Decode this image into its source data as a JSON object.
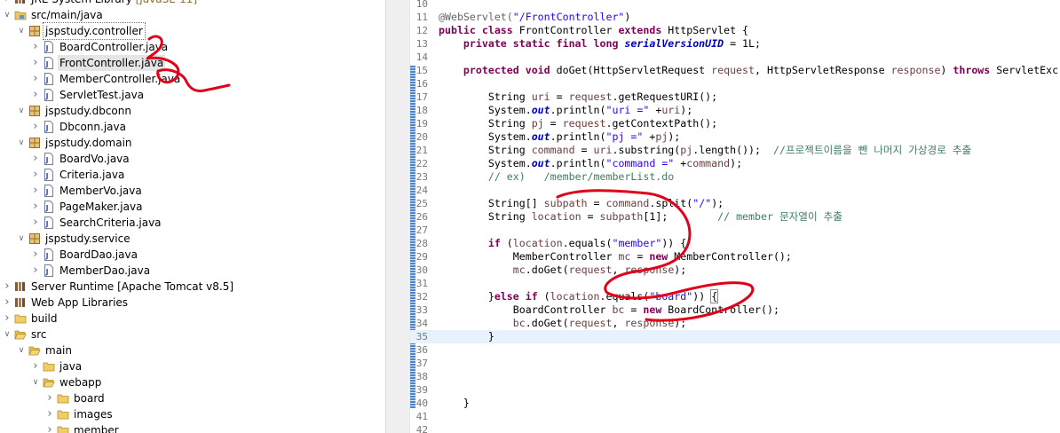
{
  "explorer": {
    "items": [
      {
        "label": "JRE System Library",
        "suffix": " [JavaSE-11]",
        "icon": "library-icon",
        "depth": 0,
        "arrow": "collapsed"
      },
      {
        "label": "src/main/java",
        "icon": "source-folder-icon",
        "depth": 0,
        "arrow": "expanded"
      },
      {
        "label": "jspstudy.controller",
        "icon": "package-icon",
        "depth": 1,
        "arrow": "expanded",
        "boxed": true
      },
      {
        "label": "BoardController.java",
        "icon": "java-file-icon",
        "depth": 2,
        "arrow": "collapsed"
      },
      {
        "label": "FrontController.java",
        "icon": "java-file-icon",
        "depth": 2,
        "arrow": "collapsed",
        "selected": true
      },
      {
        "label": "MemberController.java",
        "icon": "java-file-icon",
        "depth": 2,
        "arrow": "collapsed"
      },
      {
        "label": "ServletTest.java",
        "icon": "java-file-icon",
        "depth": 2,
        "arrow": "collapsed"
      },
      {
        "label": "jspstudy.dbconn",
        "icon": "package-icon",
        "depth": 1,
        "arrow": "expanded"
      },
      {
        "label": "Dbconn.java",
        "icon": "java-file-icon",
        "depth": 2,
        "arrow": "collapsed"
      },
      {
        "label": "jspstudy.domain",
        "icon": "package-icon",
        "depth": 1,
        "arrow": "expanded"
      },
      {
        "label": "BoardVo.java",
        "icon": "java-file-icon",
        "depth": 2,
        "arrow": "collapsed"
      },
      {
        "label": "Criteria.java",
        "icon": "java-file-icon",
        "depth": 2,
        "arrow": "collapsed"
      },
      {
        "label": "MemberVo.java",
        "icon": "java-file-icon",
        "depth": 2,
        "arrow": "collapsed"
      },
      {
        "label": "PageMaker.java",
        "icon": "java-file-icon",
        "depth": 2,
        "arrow": "collapsed"
      },
      {
        "label": "SearchCriteria.java",
        "icon": "java-file-icon",
        "depth": 2,
        "arrow": "collapsed"
      },
      {
        "label": "jspstudy.service",
        "icon": "package-icon",
        "depth": 1,
        "arrow": "expanded"
      },
      {
        "label": "BoardDao.java",
        "icon": "java-file-icon",
        "depth": 2,
        "arrow": "collapsed"
      },
      {
        "label": "MemberDao.java",
        "icon": "java-file-icon",
        "depth": 2,
        "arrow": "collapsed"
      },
      {
        "label": "Server Runtime [Apache Tomcat v8.5]",
        "icon": "library-icon",
        "depth": 0,
        "arrow": "collapsed"
      },
      {
        "label": "Web App Libraries",
        "icon": "library-icon",
        "depth": 0,
        "arrow": "collapsed"
      },
      {
        "label": "build",
        "icon": "folder-icon",
        "depth": 0,
        "arrow": "collapsed"
      },
      {
        "label": "src",
        "icon": "folder-open-icon",
        "depth": 0,
        "arrow": "expanded"
      },
      {
        "label": "main",
        "icon": "folder-open-icon",
        "depth": 1,
        "arrow": "expanded"
      },
      {
        "label": "java",
        "icon": "folder-icon",
        "depth": 2,
        "arrow": "collapsed"
      },
      {
        "label": "webapp",
        "icon": "folder-open-icon",
        "depth": 2,
        "arrow": "expanded"
      },
      {
        "label": "board",
        "icon": "folder-icon",
        "depth": 3,
        "arrow": "collapsed"
      },
      {
        "label": "images",
        "icon": "folder-icon",
        "depth": 3,
        "arrow": "collapsed"
      },
      {
        "label": "member",
        "icon": "folder-icon",
        "depth": 3,
        "arrow": "collapsed"
      }
    ]
  },
  "editor": {
    "current_line": "35",
    "lines": [
      {
        "n": "10",
        "tokens": []
      },
      {
        "n": "11",
        "tokens": [
          {
            "t": "ann",
            "v": "@WebServlet("
          },
          {
            "t": "str",
            "v": "\"/FrontController\""
          },
          {
            "t": "",
            "v": ")"
          }
        ]
      },
      {
        "n": "12",
        "tokens": [
          {
            "t": "kw",
            "v": "public class"
          },
          {
            "t": "",
            "v": " FrontController "
          },
          {
            "t": "kw",
            "v": "extends"
          },
          {
            "t": "",
            "v": " HttpServlet {"
          }
        ]
      },
      {
        "n": "13",
        "tokens": [
          {
            "t": "",
            "v": "    "
          },
          {
            "t": "kw",
            "v": "private static final long"
          },
          {
            "t": "",
            "v": " "
          },
          {
            "t": "sfld",
            "v": "serialVersionUID"
          },
          {
            "t": "",
            "v": " = 1L;"
          }
        ]
      },
      {
        "n": "14",
        "tokens": []
      },
      {
        "n": "15",
        "fold": true,
        "tokens": [
          {
            "t": "",
            "v": "    "
          },
          {
            "t": "kw",
            "v": "protected void"
          },
          {
            "t": "",
            "v": " doGet(HttpServletRequest "
          },
          {
            "t": "lvar",
            "v": "request"
          },
          {
            "t": "",
            "v": ", HttpServletResponse "
          },
          {
            "t": "lvar",
            "v": "response"
          },
          {
            "t": "",
            "v": ") "
          },
          {
            "t": "kw",
            "v": "throws"
          },
          {
            "t": "",
            "v": " ServletExc"
          }
        ]
      },
      {
        "n": "16",
        "tokens": []
      },
      {
        "n": "17",
        "tokens": [
          {
            "t": "",
            "v": "        String "
          },
          {
            "t": "lvar",
            "v": "uri"
          },
          {
            "t": "",
            "v": " = "
          },
          {
            "t": "lvar",
            "v": "request"
          },
          {
            "t": "",
            "v": ".getRequestURI();"
          }
        ]
      },
      {
        "n": "18",
        "tokens": [
          {
            "t": "",
            "v": "        System."
          },
          {
            "t": "sfld",
            "v": "out"
          },
          {
            "t": "",
            "v": ".println("
          },
          {
            "t": "str",
            "v": "\"uri =\""
          },
          {
            "t": "",
            "v": " +"
          },
          {
            "t": "lvar",
            "v": "uri"
          },
          {
            "t": "",
            "v": ");"
          }
        ]
      },
      {
        "n": "19",
        "tokens": [
          {
            "t": "",
            "v": "        String "
          },
          {
            "t": "lvar",
            "v": "pj"
          },
          {
            "t": "",
            "v": " = "
          },
          {
            "t": "lvar",
            "v": "request"
          },
          {
            "t": "",
            "v": ".getContextPath();"
          }
        ]
      },
      {
        "n": "20",
        "tokens": [
          {
            "t": "",
            "v": "        System."
          },
          {
            "t": "sfld",
            "v": "out"
          },
          {
            "t": "",
            "v": ".println("
          },
          {
            "t": "str",
            "v": "\"pj =\""
          },
          {
            "t": "",
            "v": " +"
          },
          {
            "t": "lvar",
            "v": "pj"
          },
          {
            "t": "",
            "v": ");"
          }
        ]
      },
      {
        "n": "21",
        "tokens": [
          {
            "t": "",
            "v": "        String "
          },
          {
            "t": "lvar",
            "v": "command"
          },
          {
            "t": "",
            "v": " = "
          },
          {
            "t": "lvar",
            "v": "uri"
          },
          {
            "t": "",
            "v": ".substring("
          },
          {
            "t": "lvar",
            "v": "pj"
          },
          {
            "t": "",
            "v": ".length());  "
          },
          {
            "t": "cmt",
            "v": "//프로젝트이름을 뺀 나머지 가상경로 추출"
          }
        ]
      },
      {
        "n": "22",
        "tokens": [
          {
            "t": "",
            "v": "        System."
          },
          {
            "t": "sfld",
            "v": "out"
          },
          {
            "t": "",
            "v": ".println("
          },
          {
            "t": "str",
            "v": "\"command =\""
          },
          {
            "t": "",
            "v": " +"
          },
          {
            "t": "lvar",
            "v": "command"
          },
          {
            "t": "",
            "v": ");"
          }
        ]
      },
      {
        "n": "23",
        "tokens": [
          {
            "t": "",
            "v": "        "
          },
          {
            "t": "cmt",
            "v": "// ex)   /member/memberList.do"
          }
        ]
      },
      {
        "n": "24",
        "tokens": []
      },
      {
        "n": "25",
        "tokens": [
          {
            "t": "",
            "v": "        String[] "
          },
          {
            "t": "lvar",
            "v": "subpath"
          },
          {
            "t": "",
            "v": " = "
          },
          {
            "t": "lvar",
            "v": "command"
          },
          {
            "t": "",
            "v": ".split("
          },
          {
            "t": "str",
            "v": "\"/\""
          },
          {
            "t": "",
            "v": ");"
          }
        ]
      },
      {
        "n": "26",
        "tokens": [
          {
            "t": "",
            "v": "        String "
          },
          {
            "t": "lvar",
            "v": "location"
          },
          {
            "t": "",
            "v": " = "
          },
          {
            "t": "lvar",
            "v": "subpath"
          },
          {
            "t": "",
            "v": "[1];        "
          },
          {
            "t": "cmt",
            "v": "// member 문자열이 추출"
          }
        ]
      },
      {
        "n": "27",
        "tokens": []
      },
      {
        "n": "28",
        "tokens": [
          {
            "t": "",
            "v": "        "
          },
          {
            "t": "kw",
            "v": "if"
          },
          {
            "t": "",
            "v": " ("
          },
          {
            "t": "lvar",
            "v": "location"
          },
          {
            "t": "",
            "v": ".equals("
          },
          {
            "t": "str",
            "v": "\"member\""
          },
          {
            "t": "",
            "v": ")) {"
          }
        ]
      },
      {
        "n": "29",
        "tokens": [
          {
            "t": "",
            "v": "            MemberController "
          },
          {
            "t": "lvar",
            "v": "mc"
          },
          {
            "t": "",
            "v": " = "
          },
          {
            "t": "kw",
            "v": "new"
          },
          {
            "t": "",
            "v": " MemberController();"
          }
        ]
      },
      {
        "n": "30",
        "tokens": [
          {
            "t": "",
            "v": "            "
          },
          {
            "t": "lvar",
            "v": "mc"
          },
          {
            "t": "",
            "v": ".doGet("
          },
          {
            "t": "lvar",
            "v": "request"
          },
          {
            "t": "",
            "v": ", "
          },
          {
            "t": "lvar",
            "v": "response"
          },
          {
            "t": "",
            "v": ");"
          }
        ]
      },
      {
        "n": "31",
        "tokens": []
      },
      {
        "n": "32",
        "tokens": [
          {
            "t": "",
            "v": "        }"
          },
          {
            "t": "kw",
            "v": "else if"
          },
          {
            "t": "",
            "v": " ("
          },
          {
            "t": "lvar",
            "v": "location"
          },
          {
            "t": "",
            "v": ".equals("
          },
          {
            "t": "str",
            "v": "\"board\""
          },
          {
            "t": "",
            "v": ")) "
          },
          {
            "t": "box",
            "v": "{"
          }
        ]
      },
      {
        "n": "33",
        "tokens": [
          {
            "t": "",
            "v": "            BoardController "
          },
          {
            "t": "lvar",
            "v": "bc"
          },
          {
            "t": "",
            "v": " = "
          },
          {
            "t": "kw",
            "v": "new"
          },
          {
            "t": "",
            "v": " BoardController();"
          }
        ]
      },
      {
        "n": "34",
        "tokens": [
          {
            "t": "",
            "v": "            "
          },
          {
            "t": "lvar",
            "v": "bc"
          },
          {
            "t": "",
            "v": ".doGet("
          },
          {
            "t": "lvar",
            "v": "request"
          },
          {
            "t": "",
            "v": ", "
          },
          {
            "t": "lvar",
            "v": "response"
          },
          {
            "t": "",
            "v": ");"
          }
        ]
      },
      {
        "n": "35",
        "tokens": [
          {
            "t": "",
            "v": "        }"
          }
        ]
      },
      {
        "n": "36",
        "tokens": []
      },
      {
        "n": "37",
        "tokens": []
      },
      {
        "n": "38",
        "tokens": []
      },
      {
        "n": "39",
        "tokens": []
      },
      {
        "n": "40",
        "tokens": [
          {
            "t": "",
            "v": "    }"
          }
        ]
      },
      {
        "n": "41",
        "tokens": []
      },
      {
        "n": "42",
        "tokens": []
      }
    ]
  },
  "colors": {
    "keyword": "#7f0055",
    "string": "#2a00ff",
    "comment": "#3f7f5f",
    "annotation": "#646464",
    "field": "#0000c0",
    "local_variable": "#6a3e3e",
    "current_line": "#e8f2fe",
    "scribble": "#e0001a"
  }
}
